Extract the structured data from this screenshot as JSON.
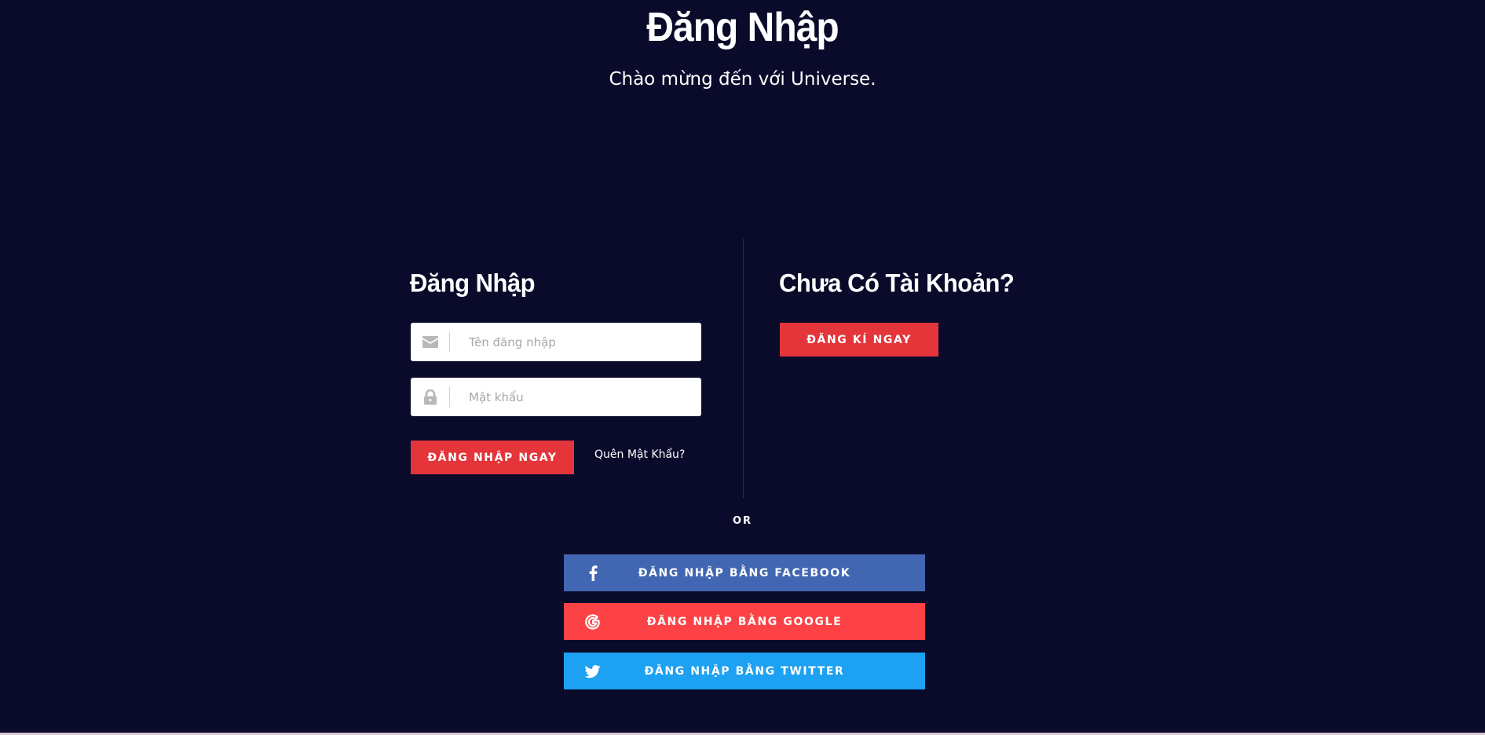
{
  "header": {
    "title": "Đăng Nhập",
    "subtitle": "Chào mừng đến với Universe."
  },
  "login": {
    "title": "Đăng Nhập",
    "username_placeholder": "Tên đăng nhập",
    "password_placeholder": "Mật khẩu",
    "submit_label": "ĐĂNG NHẬP NGAY",
    "forgot_label": "Quên Mật Khẩu?"
  },
  "signup": {
    "title": "Chưa Có Tài Khoản?",
    "button_label": "ĐĂNG KÍ NGAY"
  },
  "separator": {
    "or_label": "OR"
  },
  "social": {
    "facebook_label": "ĐĂNG NHẬP BẰNG FACEBOOK",
    "google_label": "ĐĂNG NHẬP BẰNG GOOGLE",
    "twitter_label": "ĐĂNG NHẬP BẰNG TWITTER"
  },
  "icons": {
    "username": "envelope-icon",
    "password": "lock-icon",
    "facebook": "facebook-icon",
    "google": "google-icon",
    "twitter": "twitter-icon"
  },
  "colors": {
    "background": "#0a0b2b",
    "accent_red": "#e3353a",
    "facebook": "#4267b2",
    "google": "#fd4246",
    "twitter": "#1da1f2"
  }
}
